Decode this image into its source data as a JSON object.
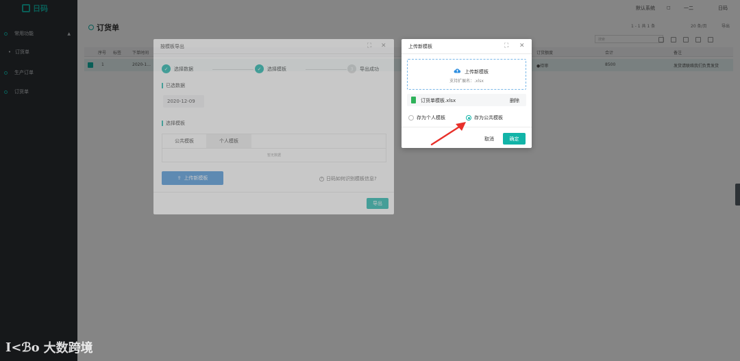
{
  "app": {
    "logo_text": "日码"
  },
  "topbar": {
    "system": "默认系统",
    "user_left": "一二",
    "user_right": "日码"
  },
  "sidebar": {
    "items": [
      {
        "label": "常用功能"
      },
      {
        "label": "订货单"
      },
      {
        "label": "生产订单"
      },
      {
        "label": "订货单"
      }
    ]
  },
  "page": {
    "title": "订货单"
  },
  "table": {
    "headers": [
      "序号",
      "标签",
      "下单时间",
      "订货额度",
      "合计",
      "备注"
    ],
    "row": {
      "index": "1",
      "date": "2020-1...",
      "status": "●待审",
      "total": "8500",
      "remark": "发货请联络我们负责发货"
    }
  },
  "pager": {
    "range": "1 - 1 共 1 条",
    "page_size": "20 条/页",
    "export": "导出"
  },
  "search": {
    "placeholder": "搜索"
  },
  "export_dialog": {
    "title": "按模板导出",
    "steps": [
      {
        "label": "选择数据"
      },
      {
        "label": "选择模板"
      },
      {
        "num": "3",
        "label": "导出成功"
      }
    ],
    "selected_section": "已选数据",
    "selected_date": "2020-12-09",
    "template_section": "选择模板",
    "tabs": [
      {
        "label": "公共模板"
      },
      {
        "label": "个人模板"
      }
    ],
    "empty_text": "暂无数据",
    "upload_button": "上传新模板",
    "help_text": "日码如何识别模板信息?",
    "export_button": "导出"
  },
  "upload_dialog": {
    "title": "上传新模板",
    "drop_title": "上传新模板",
    "drop_subtitle": "支持扩展名：.xlsx",
    "file_name": "订货单模板.xlsx",
    "delete_label": "删除",
    "radio_personal": "存为个人模板",
    "radio_public": "存为公共模板",
    "selected_radio": "public",
    "cancel_button": "取消",
    "ok_button": "确定"
  },
  "watermark": {
    "logo": "I<ℬo",
    "text": "大数跨境"
  },
  "colors": {
    "accent": "#12b4a8",
    "upload_button": "#3f8fd8",
    "sidebar": "#2b2f33",
    "arrow": "#e8302a"
  }
}
